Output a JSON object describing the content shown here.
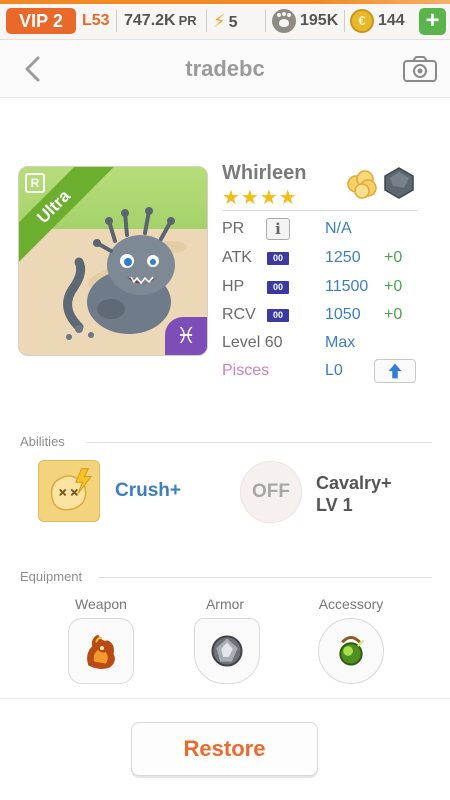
{
  "status_bar": {
    "vip": "VIP 2",
    "level": "L53",
    "pr_value": "747.2K",
    "pr_unit": "PR",
    "energy": "5",
    "food": "195K",
    "gold": "144",
    "add_label": "+"
  },
  "header": {
    "title": "tradebc"
  },
  "pet": {
    "name": "Whirleen",
    "stars": "★★★★",
    "rarity": "Ultra",
    "corner_badge": "R",
    "zodiac_symbol": "♓",
    "stats": {
      "pr": {
        "label": "PR",
        "value": "N/A",
        "info": "i"
      },
      "atk": {
        "label": "ATK",
        "badge": "00",
        "value": "1250",
        "bonus": "+0"
      },
      "hp": {
        "label": "HP",
        "badge": "00",
        "value": "11500",
        "bonus": "+0"
      },
      "rcv": {
        "label": "RCV",
        "badge": "00",
        "value": "1050",
        "bonus": "+0"
      },
      "level": {
        "label": "Level 60",
        "value": "Max"
      },
      "zodiac": {
        "label": "Pisces",
        "value": "L0"
      }
    }
  },
  "abilities": {
    "section_title": "Abilities",
    "primary": {
      "name": "Crush+"
    },
    "secondary": {
      "status": "OFF",
      "name_line1": "Cavalry+",
      "name_line2": "LV 1"
    }
  },
  "equipment": {
    "section_title": "Equipment",
    "slots": [
      {
        "label": "Weapon"
      },
      {
        "label": "Armor"
      },
      {
        "label": "Accessory"
      }
    ]
  },
  "footer": {
    "restore_label": "Restore"
  },
  "colors": {
    "accent_orange": "#e8692a",
    "stat_blue": "#3c7ec0",
    "bonus_green": "#4ba64b",
    "rarity_green": "#6cae2d",
    "zodiac_purple": "#7d4db8"
  }
}
